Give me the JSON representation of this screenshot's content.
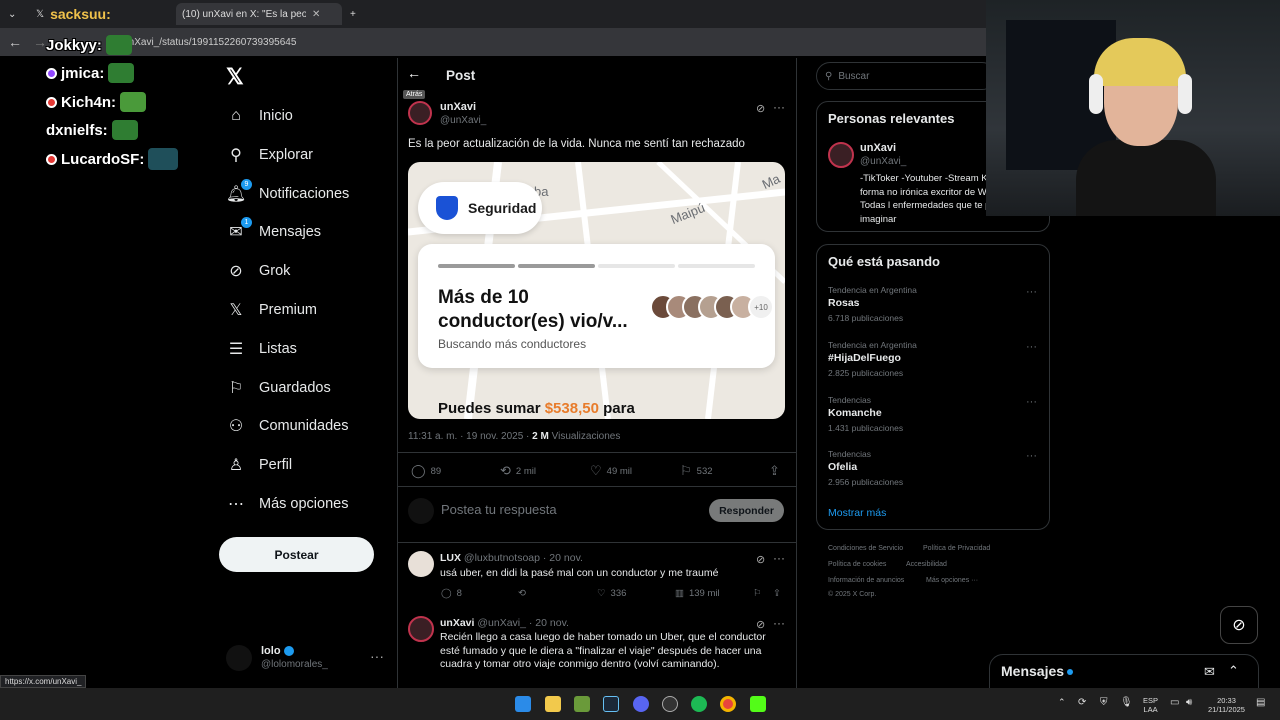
{
  "browser": {
    "tab1_label": "sacksuu:",
    "tab2_label": "(10) unXavi en X: \"Es la peor ac",
    "tab_close": "✕",
    "new_tab": "+",
    "url": "m/unXavi_/status/1991152260739395645",
    "status_url": "https://x.com/unXavi_"
  },
  "chat_overlay": {
    "lines": [
      {
        "user": "Jokkyy:"
      },
      {
        "user": "jmica:",
        "badge_color": "#9147ff"
      },
      {
        "user": "Kich4n:",
        "badge_color": "#e53935"
      },
      {
        "user": "dxnielfs:"
      },
      {
        "user": "LucardoSF:",
        "badge_color": "#e53935"
      }
    ]
  },
  "nav": {
    "logo": "𝕏",
    "items": [
      {
        "label": "Inicio",
        "icon": "home-icon",
        "glyph": "⌂"
      },
      {
        "label": "Explorar",
        "icon": "search-icon",
        "glyph": "⚲"
      },
      {
        "label": "Notificaciones",
        "icon": "bell-icon",
        "glyph": "🔔︎",
        "badge": "9"
      },
      {
        "label": "Mensajes",
        "icon": "mail-icon",
        "glyph": "✉",
        "badge": "1"
      },
      {
        "label": "Grok",
        "icon": "grok-icon",
        "glyph": "⊘"
      },
      {
        "label": "Premium",
        "icon": "x-icon",
        "glyph": "𝕏"
      },
      {
        "label": "Listas",
        "icon": "list-icon",
        "glyph": "☰"
      },
      {
        "label": "Guardados",
        "icon": "bookmark-icon",
        "glyph": "⚐"
      },
      {
        "label": "Comunidades",
        "icon": "people-icon",
        "glyph": "⚇"
      },
      {
        "label": "Perfil",
        "icon": "user-icon",
        "glyph": "♙"
      },
      {
        "label": "Más opciones",
        "icon": "more-circle-icon",
        "glyph": "⋯"
      }
    ],
    "post_button": "Postear",
    "account": {
      "name": "lolo",
      "handle": "@lolomorales_",
      "more": "···"
    }
  },
  "post": {
    "header_title": "Post",
    "back_tooltip": "Atrás",
    "author_name": "unXavi",
    "author_handle": "@unXavi_",
    "text": "Es la peor actualización de la vida. Nunca me sentí tan rechazado",
    "media": {
      "streets": [
        "ba",
        "Maipú",
        "Ma"
      ],
      "security_label": "Seguridad",
      "title": "Más de 10 conductor(es) vio/v...",
      "subtitle": "Buscando más conductores",
      "plus_count": "+10",
      "bottom_prefix": "Puedes sumar ",
      "bottom_amount": "$538,50",
      "bottom_suffix": " para"
    },
    "timestamp": "11:31 a. m. · 19 nov. 2025 · ",
    "views_count": "2 M",
    "views_label": " Visualizaciones",
    "stats": {
      "replies": "89",
      "reposts": "2 mil",
      "likes": "49 mil",
      "bookmarks": "532"
    },
    "reply_placeholder": "Postea tu respuesta",
    "reply_button": "Responder"
  },
  "replies": [
    {
      "name": "LUX",
      "meta": " @luxbutnotsoap · 20 nov.",
      "text": "usá uber, en didi la pasé mal con un conductor y me traumé",
      "replies": "8",
      "likes": "336",
      "views": "139 mil"
    },
    {
      "name": "unXavi",
      "meta": " @unXavi_ · 20 nov.",
      "text": "Recién llego a casa luego de haber tomado un Uber, que el conductor esté fumado y que le diera a \"finalizar el viaje\" después de hacer una cuadra y tomar otro viaje conmigo dentro (volví caminando)."
    }
  ],
  "sidebar": {
    "search_placeholder": "Buscar",
    "relevant_title": "Personas relevantes",
    "relevant_name": "unXavi",
    "relevant_handle": "@unXavi_",
    "relevant_bio": "-TikToker -Youtuber -Stream Kpoper de forma no irónica excritor de Wattpad Todas l enfermedades que te podes imaginar",
    "trends_title": "Qué está pasando",
    "trends": [
      {
        "category": "Tendencia en Argentina",
        "name": "Rosas",
        "count": "6.718 publicaciones"
      },
      {
        "category": "Tendencia en Argentina",
        "name": "#HijaDelFuego",
        "count": "2.825 publicaciones"
      },
      {
        "category": "Tendencias",
        "name": "Komanche",
        "count": "1.431 publicaciones"
      },
      {
        "category": "Tendencias",
        "name": "Ofelia",
        "count": "2.956 publicaciones"
      }
    ],
    "show_more": "Mostrar más",
    "footer": {
      "terms": "Condiciones de Servicio",
      "privacy": "Política de Privacidad",
      "cookies": "Política de cookies",
      "access": "Accesibilidad",
      "ads": "Información de anuncios",
      "more": "Más opciones ···",
      "copyright": "© 2025 X Corp."
    }
  },
  "messages": {
    "title": "Mensajes"
  },
  "taskbar": {
    "lang1": "ESP",
    "lang2": "LAA",
    "time": "20:33",
    "date": "21/11/2025"
  },
  "colors": {
    "accent": "#1d9bf0",
    "amount": "#e87c2b",
    "uber_shield": "#1a52d6"
  }
}
